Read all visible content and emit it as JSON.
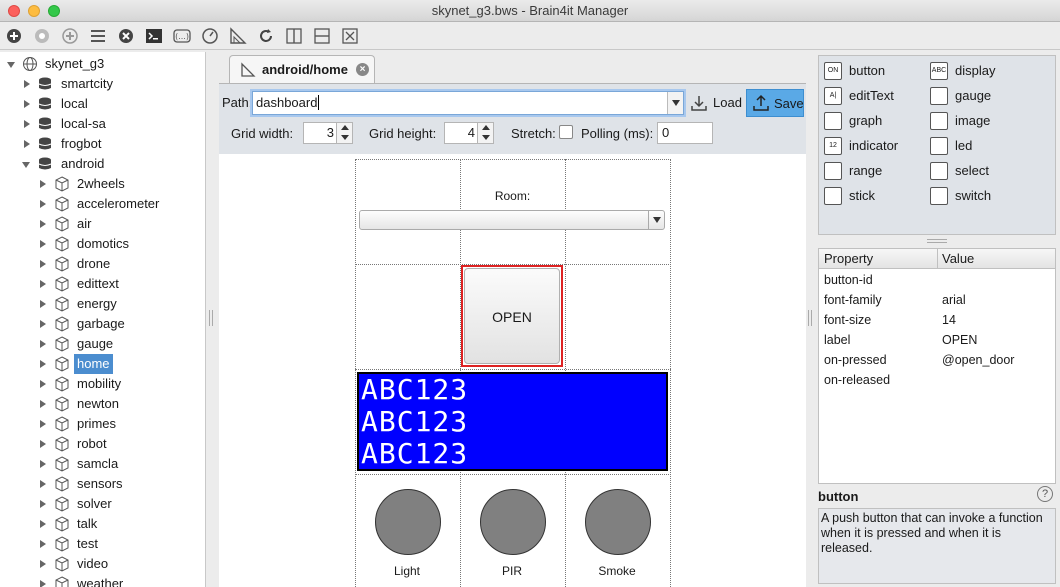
{
  "window": {
    "title": "skynet_g3.bws - Brain4it Manager"
  },
  "toolbar": {
    "icons": [
      "add-icon",
      "star-icon",
      "add-icon",
      "list-icon",
      "close-circle-icon",
      "terminal-icon",
      "function-icon",
      "gauge-icon",
      "triangle-ruler-icon",
      "refresh-icon",
      "split-horizontal-icon",
      "split-vertical-icon",
      "close-box-icon"
    ]
  },
  "tree": {
    "root": "skynet_g3",
    "modules": [
      "smartcity",
      "local",
      "local-sa",
      "frogbot",
      "android"
    ],
    "android_children": [
      "2wheels",
      "accelerometer",
      "air",
      "domotics",
      "drone",
      "edittext",
      "energy",
      "garbage",
      "gauge",
      "home",
      "mobility",
      "newton",
      "primes",
      "robot",
      "samcla",
      "sensors",
      "solver",
      "talk",
      "test",
      "video",
      "weather"
    ],
    "selected": "home"
  },
  "editor": {
    "tab_label": "android/home",
    "path_label": "Path:",
    "path_value": "dashboard",
    "load_label": "Load",
    "save_label": "Save",
    "grid_width_label": "Grid width:",
    "grid_width_value": "3",
    "grid_height_label": "Grid height:",
    "grid_height_value": "4",
    "stretch_label": "Stretch:",
    "polling_label": "Polling (ms):",
    "polling_value": "0"
  },
  "dashboard": {
    "room_label": "Room:",
    "open_button_label": "OPEN",
    "display_lines": [
      "ABC123",
      "ABC123",
      "ABC123"
    ],
    "gauges": [
      "Light",
      "PIR",
      "Smoke"
    ],
    "display_color": "#0000ff"
  },
  "palette": {
    "items": [
      {
        "label": "button",
        "icon": "button-icon",
        "badge": "ON"
      },
      {
        "label": "display",
        "icon": "display-icon",
        "badge": "ABC"
      },
      {
        "label": "editText",
        "icon": "edittext-icon",
        "badge": "A|"
      },
      {
        "label": "gauge",
        "icon": "gauge-icon",
        "badge": ""
      },
      {
        "label": "graph",
        "icon": "graph-icon",
        "badge": ""
      },
      {
        "label": "image",
        "icon": "image-icon",
        "badge": ""
      },
      {
        "label": "indicator",
        "icon": "indicator-icon",
        "badge": "12"
      },
      {
        "label": "led",
        "icon": "led-icon",
        "badge": ""
      },
      {
        "label": "range",
        "icon": "range-icon",
        "badge": ""
      },
      {
        "label": "select",
        "icon": "select-icon",
        "badge": ""
      },
      {
        "label": "stick",
        "icon": "stick-icon",
        "badge": ""
      },
      {
        "label": "switch",
        "icon": "switch-icon",
        "badge": ""
      }
    ]
  },
  "properties": {
    "col_property": "Property",
    "col_value": "Value",
    "rows": [
      {
        "name": "button-id",
        "value": ""
      },
      {
        "name": "font-family",
        "value": "arial"
      },
      {
        "name": "font-size",
        "value": "14"
      },
      {
        "name": "label",
        "value": "OPEN"
      },
      {
        "name": "on-pressed",
        "value": "@open_door"
      },
      {
        "name": "on-released",
        "value": ""
      }
    ]
  },
  "help": {
    "title": "button",
    "text": "A push button that can invoke a function when it is pressed and when it is released."
  }
}
